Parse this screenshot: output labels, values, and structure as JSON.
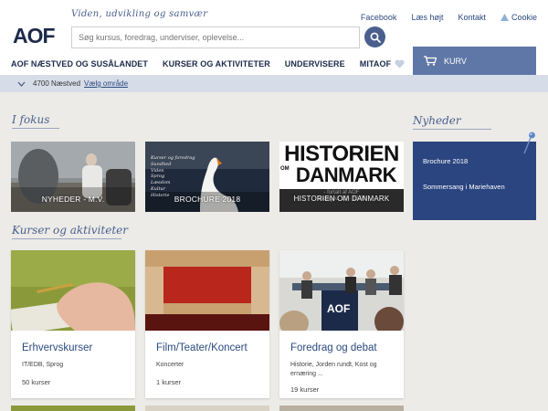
{
  "header": {
    "tagline": "Viden, udvikling og samvær",
    "search_placeholder": "Søg kursus, foredrag, underviser, oplevelse...",
    "toplinks": [
      "Facebook",
      "Læs højt",
      "Kontakt"
    ],
    "cookie_label": "Cookie",
    "nav": [
      {
        "label": "AOF NÆSTVED OG SUSÅLANDET"
      },
      {
        "label": "KURSER OG AKTIVITETER"
      },
      {
        "label": "UNDERVISERE"
      },
      {
        "label": "MITAOF"
      }
    ],
    "cart_label": "KURV"
  },
  "location": {
    "text": "4700 Næstved",
    "link": "Vælg område"
  },
  "sections": {
    "focus_heading": "I fokus",
    "news_heading": "Nyheder",
    "courses_heading": "Kurser og aktiviteter"
  },
  "focus_cards": [
    {
      "caption": "NYHEDER - M.V."
    },
    {
      "caption": "BROCHURE 2018",
      "overlay_lines": [
        "Kurser og foredrag",
        "Sundhed",
        "Viden",
        "Sprog",
        "Læsdom",
        "Kultur",
        "Historie"
      ]
    },
    {
      "caption": "HISTORIEN OM DANMARK",
      "big_line1": "HISTORIEN",
      "big_line2": "DANMARK",
      "om": "OM",
      "sub1": "- fortalt af AOF",
      "sub2": "fredag kl. 13 - 15.30"
    }
  ],
  "news_items": [
    "Brochure 2018",
    "Sommersang i Mariehaven"
  ],
  "course_cards": [
    {
      "title": "Erhvervskurser",
      "desc": "IT/EDB, Sprog",
      "count": "50 kurser"
    },
    {
      "title": "Film/Teater/Koncert",
      "desc": "Koncerter",
      "count": "1 kurser"
    },
    {
      "title": "Foredrag og debat",
      "desc": "Historie, Jorden rundt, Kost og ernæring ...",
      "count": "19 kurser"
    }
  ],
  "colors": {
    "brand_blue": "#2b4580",
    "accent": "#4a5f8d",
    "cart": "#5f77a6",
    "background": "#ecebe7"
  }
}
